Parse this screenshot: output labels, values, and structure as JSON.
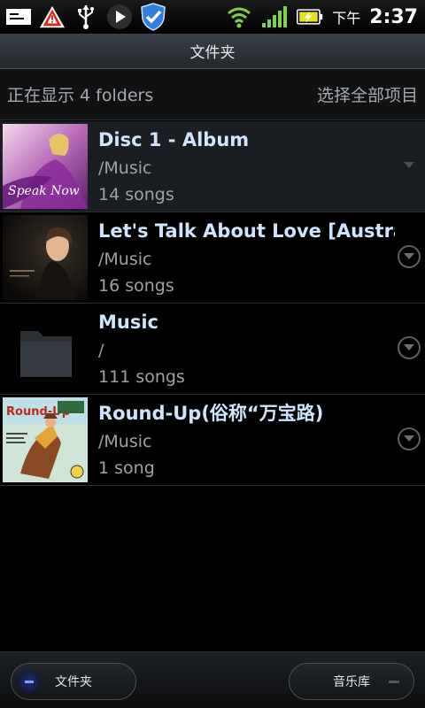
{
  "status_bar": {
    "ampm": "下午",
    "time": "2:37",
    "icons": [
      "message-icon",
      "warning-icon",
      "usb-icon",
      "play-icon",
      "shield-check-icon",
      "wifi-icon",
      "signal-icon",
      "battery-charging-icon"
    ]
  },
  "title_bar": {
    "title": "文件夹"
  },
  "info": {
    "showing": "正在显示 4 folders",
    "select_all": "选择全部项目"
  },
  "folders": [
    {
      "title": "Disc 1 - Album",
      "path": "/Music",
      "count": "14 songs",
      "thumb": "album-cover"
    },
    {
      "title": "Let's Talk About Love [Austra",
      "path": "/Music",
      "count": "16 songs",
      "thumb": "album-cover"
    },
    {
      "title": "Music",
      "path": "/",
      "count": "111 songs",
      "thumb": "folder-icon"
    },
    {
      "title": "Round-Up(俗称“万宝路)",
      "path": "/Music",
      "count": "1 song",
      "thumb": "album-cover"
    }
  ],
  "thumb_texts": {
    "round_up": "Round-Up",
    "speak": "Speak Now"
  },
  "bottom_bar": {
    "left_label": "文件夹",
    "right_label": "音乐库"
  }
}
